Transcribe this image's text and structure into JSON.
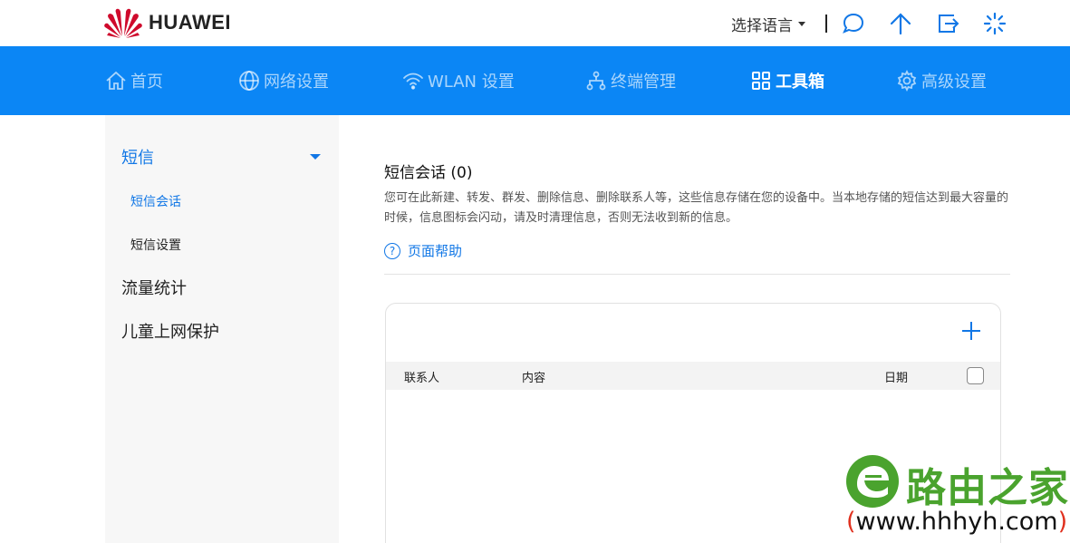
{
  "brand": {
    "name": "HUAWEI",
    "logo_color": "#cf0a2c"
  },
  "topbar": {
    "language_label": "选择语言",
    "icons": [
      "chat-bubble-icon",
      "upload-arrow-icon",
      "logout-icon",
      "loading-spinner-icon"
    ]
  },
  "nav": {
    "accent": "#0b86f5",
    "items": [
      {
        "label": "首页",
        "icon": "home-icon"
      },
      {
        "label": "网络设置",
        "icon": "globe-icon"
      },
      {
        "label": "WLAN 设置",
        "icon": "wifi-icon"
      },
      {
        "label": "终端管理",
        "icon": "network-tree-icon"
      },
      {
        "label": "工具箱",
        "icon": "grid-icon",
        "active": true
      },
      {
        "label": "高级设置",
        "icon": "gear-icon"
      }
    ]
  },
  "sidebar": {
    "sms_group": "短信",
    "sms_items": [
      "短信会话",
      "短信设置"
    ],
    "traffic": "流量统计",
    "child_protect": "儿童上网保护"
  },
  "main": {
    "title": "短信会话 (0)",
    "description": "您可在此新建、转发、群发、删除信息、删除联系人等，这些信息存储在您的设备中。当本地存储的短信达到最大容量的时候，信息图标会闪动，请及时清理信息，否则无法收到新的信息。",
    "help_label": "页面帮助",
    "help_icon": "?",
    "table": {
      "columns": [
        "联系人",
        "内容",
        "日期"
      ],
      "rows": []
    }
  },
  "watermark": {
    "title": "路由之家",
    "url_open": "(",
    "url": "www.hhhyh.com",
    "url_close": ")"
  }
}
